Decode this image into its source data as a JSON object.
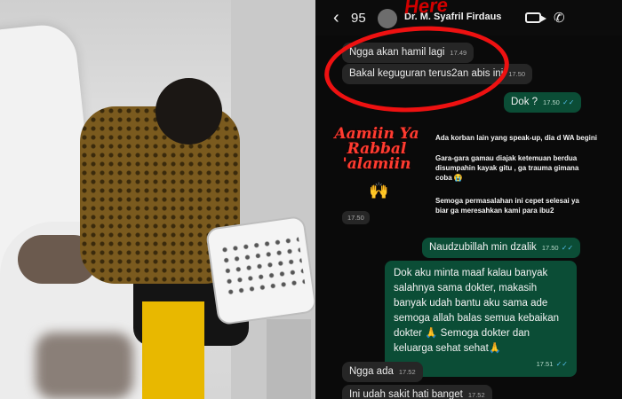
{
  "header": {
    "back_count": "95",
    "contact_name": "Dr. M. Syafril Firdaus",
    "scrawl": "Here"
  },
  "messages": [
    {
      "id": "m1",
      "text": "Ngga akan hamil lagi",
      "time": "17.49",
      "dir": "in"
    },
    {
      "id": "m2",
      "text": "Bakal keguguran terus2an abis ini",
      "time": "17.50",
      "dir": "in"
    },
    {
      "id": "m3",
      "text": "Dok ?",
      "time": "17.50",
      "dir": "out"
    },
    {
      "id": "m4",
      "text": "Naudzubillah min dzalik",
      "time": "17.50",
      "dir": "out"
    },
    {
      "id": "m5",
      "text": "Dok aku minta maaf kalau banyak salahnya sama dokter, makasih banyak udah bantu aku sama ade semoga allah balas semua kebaikan dokter 🙏 Semoga dokter dan keluarga sehat sehat🙏",
      "time": "17.51",
      "dir": "out"
    },
    {
      "id": "m6",
      "text": "Ngga ada",
      "time": "17.52",
      "dir": "in"
    },
    {
      "id": "m7",
      "text": "Ini udah sakit hati banget",
      "time": "17.52",
      "dir": "in"
    }
  ],
  "story": {
    "title": "Aamiin Ya Rabbal 'alamiin",
    "line1": "Ada korban lain yang speak-up, dia d WA begini",
    "line2": "Gara-gara gamau diajak ketemuan berdua disumpahin kayak gitu , ga trauma gimana coba 😭",
    "line3": "Semoga permasalahan ini cepet selesai ya biar ga meresahkan kami para ibu2",
    "time": "17.50"
  },
  "icons": {
    "back": "chevron-left-icon",
    "video": "video-call-icon",
    "phone": "phone-icon",
    "hands": "praying-hands-icon"
  },
  "colors": {
    "outgoing_bubble": "#0b4d36",
    "incoming_bubble": "#262626",
    "highlight": "#e11111"
  }
}
